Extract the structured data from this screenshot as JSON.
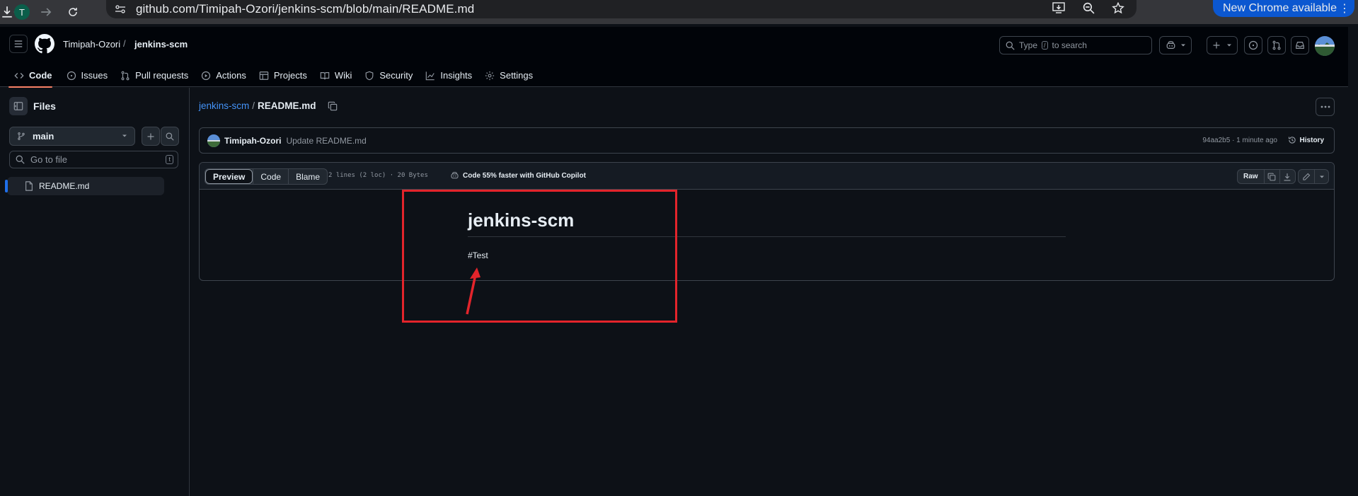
{
  "browser": {
    "url": "github.com/Timipah-Ozori/jenkins-scm/blob/main/README.md",
    "profile_initial": "T",
    "update_label": "New Chrome available",
    "accent": "#0b57d0"
  },
  "header": {
    "owner": "Timipah-Ozori",
    "separator": "/",
    "repo": "jenkins-scm",
    "search_prefix": "Type",
    "search_key": "/",
    "search_suffix": "to search"
  },
  "tabs": [
    {
      "label": "Code",
      "icon": "code-icon",
      "selected": true
    },
    {
      "label": "Issues",
      "icon": "issue-opened-icon"
    },
    {
      "label": "Pull requests",
      "icon": "git-pull-request-icon"
    },
    {
      "label": "Actions",
      "icon": "play-icon"
    },
    {
      "label": "Projects",
      "icon": "table-icon"
    },
    {
      "label": "Wiki",
      "icon": "book-icon"
    },
    {
      "label": "Security",
      "icon": "shield-icon"
    },
    {
      "label": "Insights",
      "icon": "graph-icon"
    },
    {
      "label": "Settings",
      "icon": "gear-icon"
    }
  ],
  "sidebar": {
    "title": "Files",
    "branch": "main",
    "goto_placeholder": "Go to file",
    "goto_key": "t",
    "files": [
      {
        "name": "README.md",
        "selected": true
      }
    ]
  },
  "file": {
    "repo_link": "jenkins-scm",
    "separator": "/",
    "name": "README.md"
  },
  "commit": {
    "author": "Timipah-Ozori",
    "message": "Update README.md",
    "sha_time": "94aa2b5 · 1 minute ago",
    "history_label": "History"
  },
  "file_header": {
    "views": [
      "Preview",
      "Code",
      "Blame"
    ],
    "active_view": "Preview",
    "meta": "2 lines (2 loc) · 20 Bytes",
    "copilot": "Code 55% faster with GitHub Copilot",
    "raw_label": "Raw"
  },
  "readme": {
    "heading": "jenkins-scm",
    "paragraph": "#Test"
  },
  "colors": {
    "annotation": "#e3242b",
    "tab_underline": "#f78166",
    "link": "#4493f8"
  }
}
